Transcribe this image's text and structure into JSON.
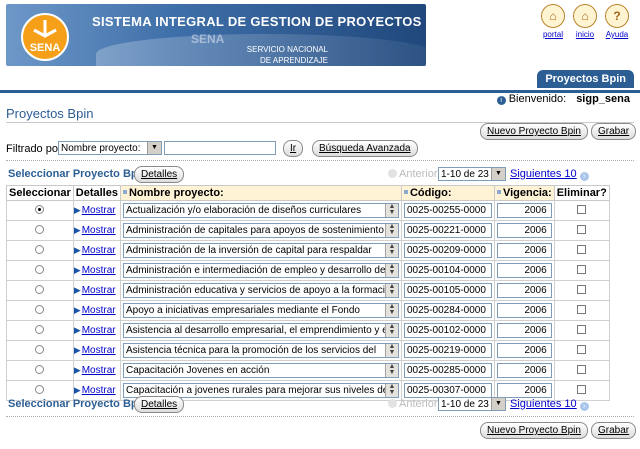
{
  "header": {
    "system_title": "SISTEMA INTEGRAL DE GESTION DE PROYECTOS",
    "logo_text": "SENA",
    "banner_brand": "SENA",
    "banner_sub1": "SERVICIO NACIONAL",
    "banner_sub2": "DE APRENDIZAJE",
    "links": [
      {
        "label": "portal",
        "icon": "home-icon"
      },
      {
        "label": "inicio",
        "icon": "house-icon"
      },
      {
        "label": "Ayuda",
        "icon": "help-icon"
      }
    ]
  },
  "tab": {
    "label": "Proyectos Bpin"
  },
  "welcome": {
    "label": "Bienvenido:",
    "user": "sigp_sena"
  },
  "page": {
    "title": "Proyectos Bpin"
  },
  "actions": {
    "new_label": "Nuevo Proyecto Bpin",
    "save_label": "Grabar"
  },
  "filter": {
    "label": "Filtrado por",
    "field": "Nombre proyecto:",
    "value": "",
    "go_label": "Ir",
    "advanced_label": "Búsqueda Avanzada"
  },
  "nav": {
    "select_label": "Seleccionar Proyecto Bpin",
    "details_label": "Detalles",
    "prev_label": "Anterior",
    "range": "1-10 de 23",
    "next_label": "Siguientes 10"
  },
  "table": {
    "headers": {
      "select": "Seleccionar",
      "details": "Detalles",
      "name": "Nombre proyecto:",
      "code": "Código:",
      "year": "Vigencia:",
      "delete": "Eliminar?"
    },
    "show_label": "Mostrar",
    "rows": [
      {
        "selected": true,
        "name": "Actualización y/o elaboración de diseños curriculares",
        "code": "0025-00255-0000",
        "year": "2006"
      },
      {
        "selected": false,
        "name": "Administración de capitales para apoyos de sostenimiento",
        "code": "0025-00221-0000",
        "year": "2006"
      },
      {
        "selected": false,
        "name": "Administración de la inversión de capital para respaldar",
        "code": "0025-00209-0000",
        "year": "2006"
      },
      {
        "selected": false,
        "name": "Administración e intermediación de empleo y desarrollo de",
        "code": "0025-00104-0000",
        "year": "2006"
      },
      {
        "selected": false,
        "name": "Administración educativa y servicios de apoyo a la formación",
        "code": "0025-00105-0000",
        "year": "2006"
      },
      {
        "selected": false,
        "name": "Apoyo a iniciativas empresariales mediante el Fondo",
        "code": "0025-00284-0000",
        "year": "2006"
      },
      {
        "selected": false,
        "name": "Asistencia al desarrollo empresarial, el emprendimiento y el",
        "code": "0025-00102-0000",
        "year": "2006"
      },
      {
        "selected": false,
        "name": "Asistencia técnica para la promoción de los servicios del",
        "code": "0025-00219-0000",
        "year": "2006"
      },
      {
        "selected": false,
        "name": "Capacitación Jovenes en acción",
        "code": "0025-00285-0000",
        "year": "2006"
      },
      {
        "selected": false,
        "name": "Capacitación a jovenes rurales para mejorar sus niveles de",
        "code": "0025-00307-0000",
        "year": "2006"
      }
    ]
  }
}
